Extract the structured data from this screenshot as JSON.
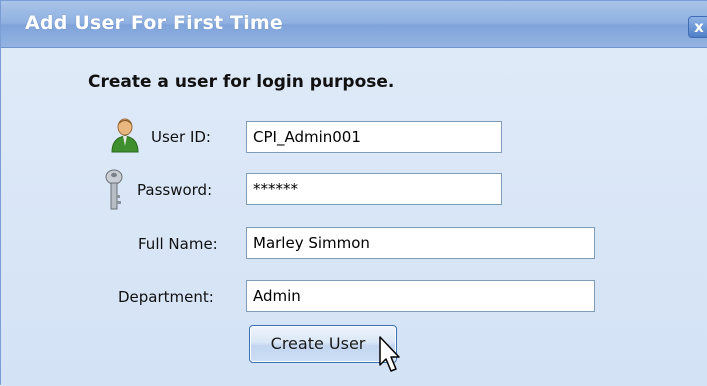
{
  "dialog": {
    "title": "Add User For First Time",
    "close_glyph": "x"
  },
  "form": {
    "heading": "Create a user for login purpose.",
    "fields": [
      {
        "label": "User ID:",
        "value": "CPI_Admin001",
        "icon": "user-icon"
      },
      {
        "label": "Password:",
        "value": "******",
        "icon": "key-icon"
      },
      {
        "label": "Full Name:",
        "value": "Marley Simmon"
      },
      {
        "label": "Department:",
        "value": "Admin"
      }
    ],
    "submit_label": "Create User"
  },
  "colors": {
    "title_bar": "#8fb0e0",
    "dialog_background": "#d6e3f5",
    "input_border": "#7f9db9",
    "button_border": "#3c6fb0"
  }
}
